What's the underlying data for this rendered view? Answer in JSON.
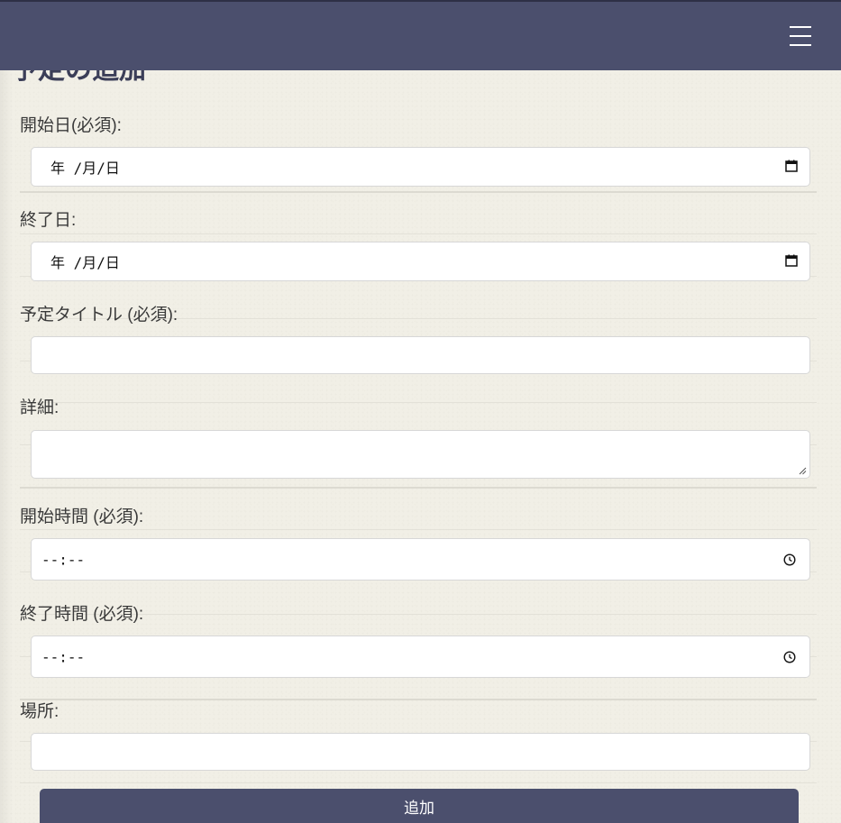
{
  "header": {
    "menu_icon": "hamburger-menu-icon"
  },
  "page": {
    "title": "予定の追加"
  },
  "form": {
    "start_date": {
      "label": "開始日(必須):",
      "value": "年 /月/日",
      "icon": "calendar-icon"
    },
    "end_date": {
      "label": "終了日:",
      "value": "年 /月/日",
      "icon": "calendar-icon"
    },
    "title": {
      "label": "予定タイトル (必須):",
      "value": ""
    },
    "details": {
      "label": "詳細:",
      "value": ""
    },
    "start_time": {
      "label": "開始時間 (必須):",
      "value": "--:--",
      "icon": "clock-icon"
    },
    "end_time": {
      "label": "終了時間 (必須):",
      "value": "--:--",
      "icon": "clock-icon"
    },
    "location": {
      "label": "場所:",
      "value": ""
    },
    "submit_label": "追加"
  },
  "colors": {
    "header_bg": "#4b4f6d",
    "page_bg": "#f1efe6",
    "button_bg": "#4b4f6d",
    "button_text": "#ffffff"
  }
}
